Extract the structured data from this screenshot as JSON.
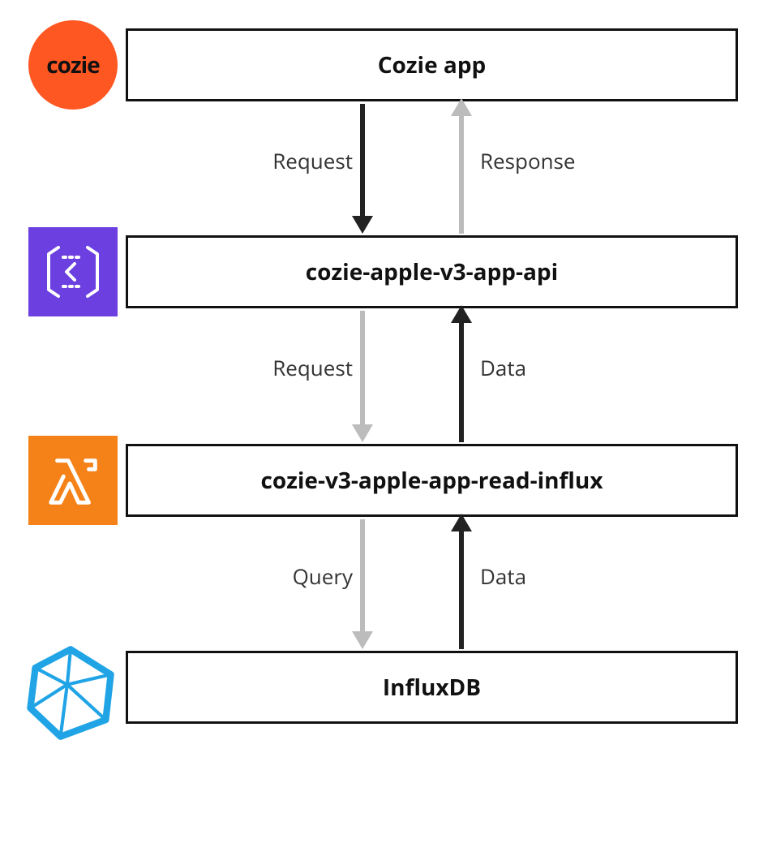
{
  "diagram": {
    "nodes": {
      "cozie_app": {
        "label": "Cozie app",
        "icon": "cozie"
      },
      "api_gw": {
        "label": "cozie-apple-v3-app-api",
        "icon": "api-gateway"
      },
      "lambda": {
        "label": "cozie-v3-apple-app-read-influx",
        "icon": "lambda"
      },
      "influx": {
        "label": "InfluxDB",
        "icon": "influxdb"
      }
    },
    "edges": {
      "e1": {
        "from": "cozie_app",
        "to": "api_gw",
        "label": "Request",
        "color": "dark",
        "dir": "down"
      },
      "e2": {
        "from": "api_gw",
        "to": "cozie_app",
        "label": "Response",
        "color": "light",
        "dir": "up"
      },
      "e3": {
        "from": "api_gw",
        "to": "lambda",
        "label": "Request",
        "color": "light",
        "dir": "down"
      },
      "e4": {
        "from": "lambda",
        "to": "api_gw",
        "label": "Data",
        "color": "dark",
        "dir": "up"
      },
      "e5": {
        "from": "lambda",
        "to": "influx",
        "label": "Query",
        "color": "light",
        "dir": "down"
      },
      "e6": {
        "from": "influx",
        "to": "lambda",
        "label": "Data",
        "color": "dark",
        "dir": "up"
      }
    },
    "icon_text": {
      "cozie": "cozie"
    }
  }
}
